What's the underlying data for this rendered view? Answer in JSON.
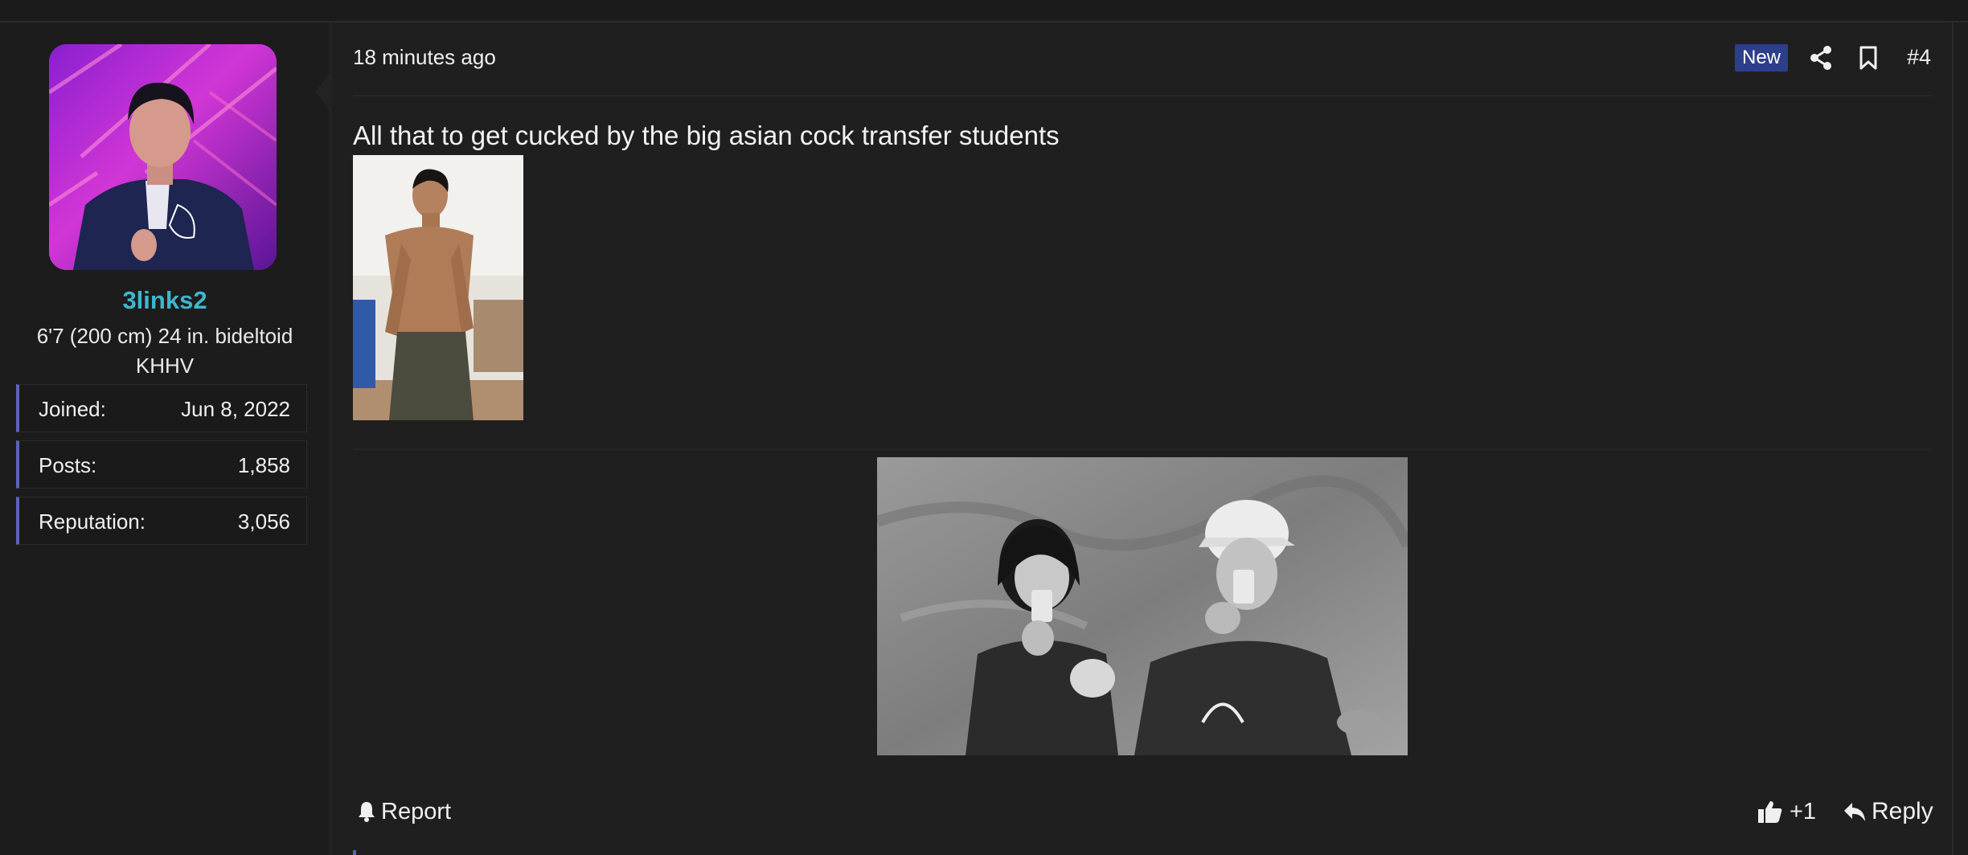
{
  "post": {
    "time": "18 minutes ago",
    "badge": "New",
    "number": "#4",
    "text": "All that to get cucked by the big asian cock transfer students"
  },
  "user": {
    "name": "3links2",
    "title_line1": "6'7 (200 cm) 24 in. bideltoid",
    "title_line2": "KHHV",
    "stats": [
      {
        "label": "Joined:",
        "value": "Jun 8, 2022"
      },
      {
        "label": "Posts:",
        "value": "1,858"
      },
      {
        "label": "Reputation:",
        "value": "3,056"
      }
    ]
  },
  "actions": {
    "report": "Report",
    "like_count": "+1",
    "reply": "Reply"
  },
  "icons": {
    "share": "share-icon",
    "bookmark": "bookmark-icon",
    "bell": "bell-icon",
    "thumbs_up": "thumbs-up-icon",
    "reply": "reply-arrow-icon"
  },
  "colors": {
    "username": "#3fb6cf",
    "badge_bg": "#2d3e8a",
    "stat_accent": "#5c63b8",
    "background": "#1f1f1f"
  }
}
